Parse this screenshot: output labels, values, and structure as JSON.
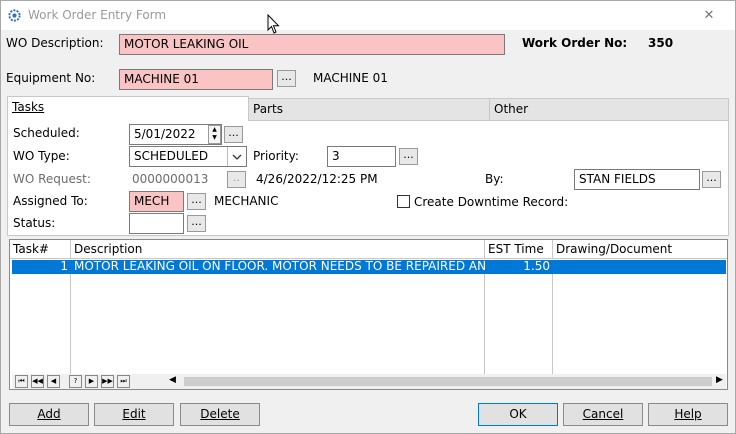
{
  "window": {
    "title": "Work Order Entry Form",
    "close_glyph": "✕"
  },
  "header": {
    "wo_description_label": "WO Description:",
    "wo_description_value": "MOTOR LEAKING OIL",
    "work_order_no_label": "Work Order  No:",
    "work_order_no_value": "350",
    "equipment_no_label": "Equipment No:",
    "equipment_no_value": "MACHINE 01",
    "equipment_name": "MACHINE 01",
    "ellipsis": "..."
  },
  "tabs": [
    {
      "label": "Tasks",
      "active": true
    },
    {
      "label": "Parts",
      "active": false
    },
    {
      "label": "Other",
      "active": false
    }
  ],
  "form": {
    "scheduled_label": "Scheduled:",
    "scheduled_value": "5/01/2022",
    "wo_type_label": "WO Type:",
    "wo_type_value": "SCHEDULED",
    "priority_label": "Priority:",
    "priority_value": "3",
    "wo_request_label": "WO Request:",
    "wo_request_value": "0000000013",
    "wo_request_btn": "..",
    "request_datetime": "4/26/2022/12:25 PM",
    "by_label": "By:",
    "by_value": "STAN FIELDS",
    "assigned_to_label": "Assigned To:",
    "assigned_to_value": "MECH",
    "assigned_to_name": "MECHANIC",
    "create_downtime_label": "Create Downtime Record:",
    "create_downtime_checked": false,
    "status_label": "Status:",
    "status_value": ""
  },
  "grid": {
    "columns": [
      "Task#",
      "Description",
      "EST Time",
      "Drawing/Document"
    ],
    "rows": [
      {
        "task": "1",
        "description": "MOTOR LEAKING OIL ON FLOOR. MOTOR NEEDS TO BE REPAIRED AND THE O",
        "est_time": "1.50",
        "drawing": "",
        "selected": true
      }
    ],
    "nav_buttons": [
      "⏮",
      "◀◀",
      "◀",
      "?",
      "▶",
      "▶▶",
      "⏭"
    ]
  },
  "buttons": {
    "add": "Add",
    "edit": "Edit",
    "delete": "Delete",
    "ok": "OK",
    "cancel": "Cancel",
    "help": "Help"
  }
}
